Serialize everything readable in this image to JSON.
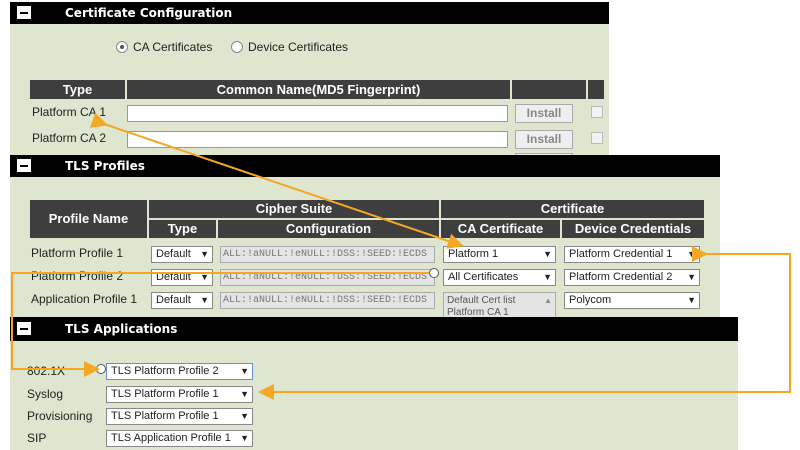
{
  "cert_config": {
    "title": "Certificate Configuration",
    "radio_ca": "CA Certificates",
    "radio_device": "Device Certificates",
    "col_type": "Type",
    "col_common_name": "Common Name(MD5 Fingerprint)",
    "rows": [
      {
        "type": "Platform CA 1",
        "install": "Install"
      },
      {
        "type": "Platform CA 2",
        "install": "Install"
      }
    ]
  },
  "tls_profiles": {
    "title": "TLS Profiles",
    "col_profile_name": "Profile Name",
    "col_cipher_suite": "Cipher Suite",
    "col_certificate": "Certificate",
    "col_type": "Type",
    "col_configuration": "Configuration",
    "col_ca_certificate": "CA Certificate",
    "col_device_credentials": "Device Credentials",
    "rows": [
      {
        "name": "Platform Profile 1",
        "type": "Default",
        "config": "ALL:!aNULL:!eNULL:!DSS:!SEED:!ECDS",
        "ca": "Platform 1",
        "cred": "Platform Credential 1"
      },
      {
        "name": "Platform Profile 2",
        "type": "Default",
        "config": "ALL:!aNULL:!eNULL:!DSS:!SEED:!ECDS",
        "ca": "All Certificates",
        "cred": "Platform Credential 2"
      },
      {
        "name": "Application Profile 1",
        "type": "Default",
        "config": "ALL:!aNULL:!eNULL:!DSS:!SEED:!ECDS",
        "ca_list": [
          "Default Cert list",
          "Platform CA 1"
        ],
        "cred": "Polycom"
      }
    ]
  },
  "tls_applications": {
    "title": "TLS Applications",
    "rows": [
      {
        "label": "802.1X",
        "value": "TLS Platform Profile 2"
      },
      {
        "label": "Syslog",
        "value": "TLS Platform Profile 1"
      },
      {
        "label": "Provisioning",
        "value": "TLS Platform Profile 1"
      },
      {
        "label": "SIP",
        "value": "TLS Application Profile 1"
      }
    ]
  },
  "colors": {
    "panel": "#dfe6cf",
    "header": "#3e3e3e",
    "bar": "#000000",
    "arrow": "#f5a623"
  },
  "icons": {
    "dropdown": "▼",
    "collapse": "minus-box-icon"
  }
}
